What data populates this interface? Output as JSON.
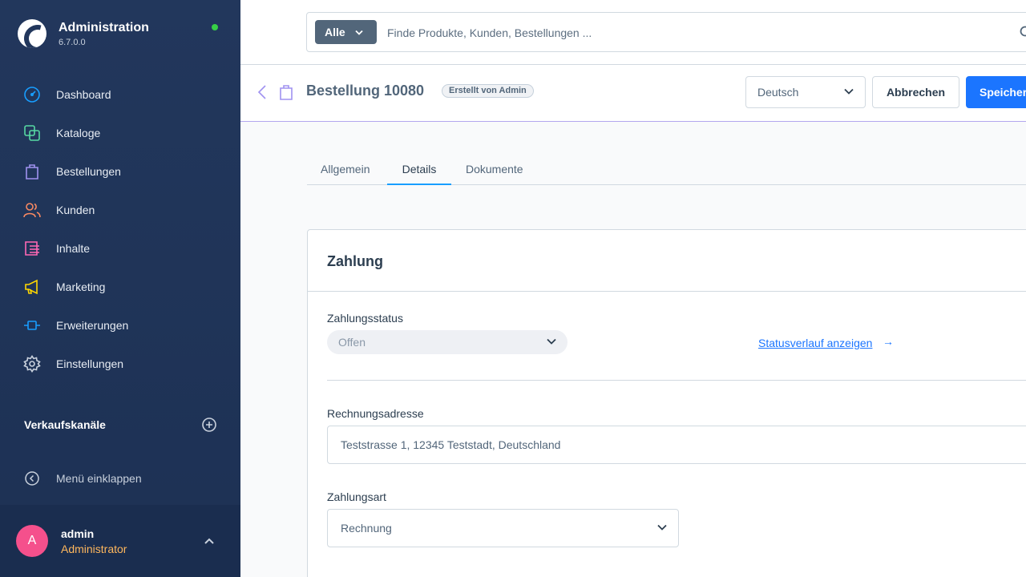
{
  "brand": {
    "title": "Administration",
    "version": "6.7.0.0"
  },
  "sidebar": {
    "items": [
      {
        "label": "Dashboard",
        "icon": "dashboard-icon",
        "color": "#189eff"
      },
      {
        "label": "Kataloge",
        "icon": "catalog-icon",
        "color": "#57d9a3"
      },
      {
        "label": "Bestellungen",
        "icon": "shopping-bag-icon",
        "color": "#a092f0"
      },
      {
        "label": "Kunden",
        "icon": "users-icon",
        "color": "#f88962"
      },
      {
        "label": "Inhalte",
        "icon": "content-icon",
        "color": "#ff68b4"
      },
      {
        "label": "Marketing",
        "icon": "megaphone-icon",
        "color": "#ffd700"
      },
      {
        "label": "Erweiterungen",
        "icon": "plug-icon",
        "color": "#189eff"
      },
      {
        "label": "Einstellungen",
        "icon": "gear-icon",
        "color": "#c9d1dd"
      }
    ],
    "sales_channels_title": "Verkaufskanäle",
    "collapse_label": "Menü einklappen"
  },
  "user": {
    "initial": "A",
    "name": "admin",
    "role": "Administrator"
  },
  "search": {
    "type_label": "Alle",
    "placeholder": "Finde Produkte, Kunden, Bestellungen ..."
  },
  "smartbar": {
    "title": "Bestellung 10080",
    "badge": "Erstellt von Admin",
    "language": "Deutsch",
    "cancel_label": "Abbrechen",
    "save_label": "Speichern"
  },
  "tabs": [
    {
      "label": "Allgemein",
      "active": false
    },
    {
      "label": "Details",
      "active": true
    },
    {
      "label": "Dokumente",
      "active": false
    }
  ],
  "payment": {
    "title": "Zahlung",
    "status_label": "Zahlungsstatus",
    "status_value": "Offen",
    "history_link": "Statusverlauf anzeigen",
    "history_arrow": "→",
    "billing_label": "Rechnungsadresse",
    "billing_value": "Teststrasse 1, 12345 Teststadt, Deutschland",
    "method_label": "Zahlungsart",
    "method_value": "Rechnung"
  }
}
